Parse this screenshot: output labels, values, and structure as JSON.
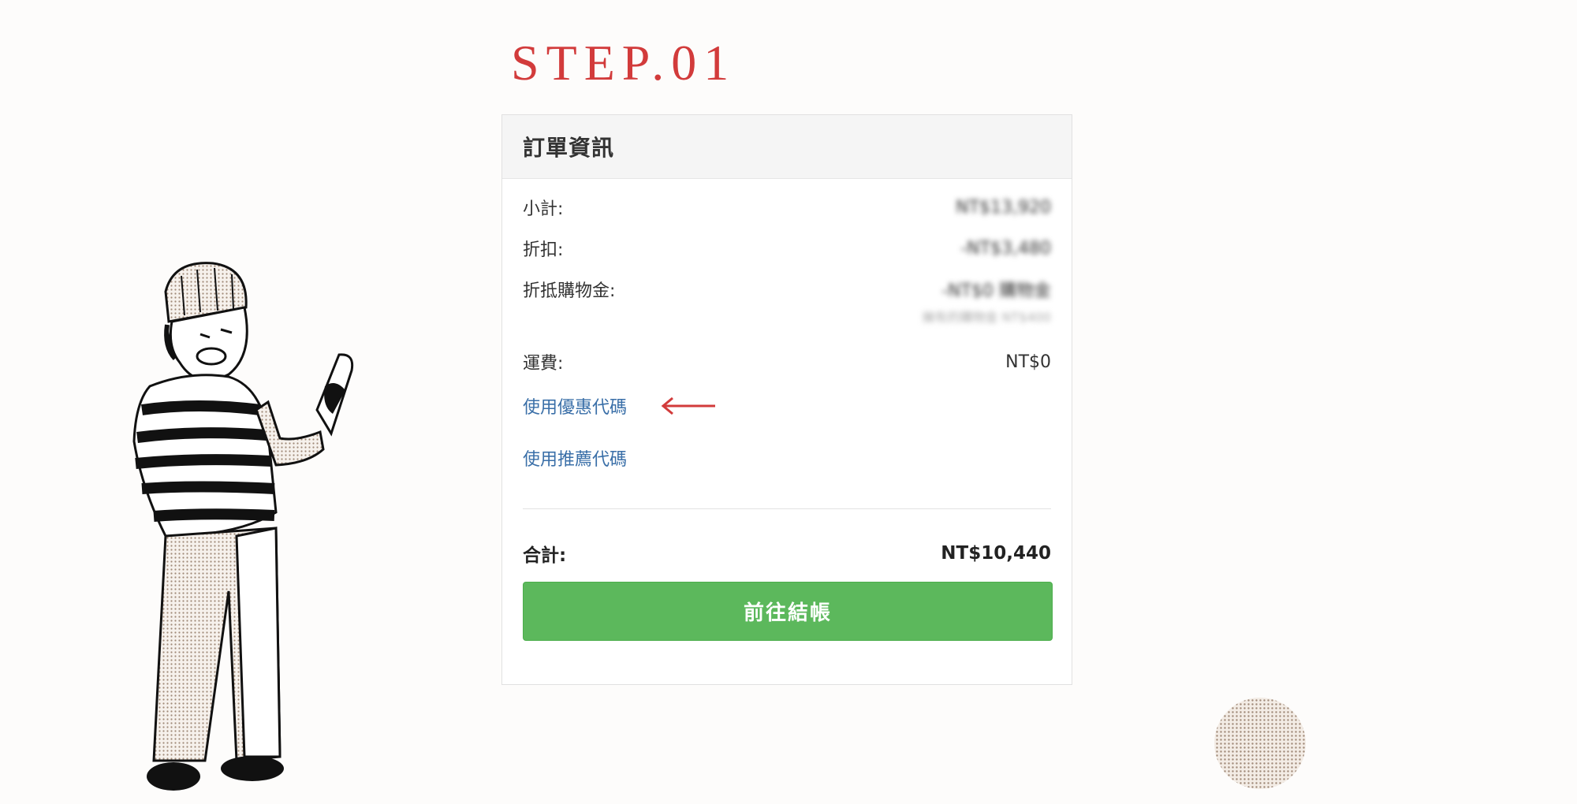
{
  "step": {
    "title": "STEP.01"
  },
  "order": {
    "title": "訂單資訊",
    "subtotal": {
      "label": "小計:",
      "value": "NT$13,920"
    },
    "discount": {
      "label": "折扣:",
      "value": "-NT$3,480"
    },
    "credit": {
      "label": "折抵購物金:",
      "value": "-NT$0 購物金",
      "note": "擁有的購物金 NT$400"
    },
    "shipping": {
      "label": "運費:",
      "value": "NT$0"
    },
    "coupon_link": "使用優惠代碼",
    "referral_link": "使用推薦代碼",
    "total": {
      "label": "合計:",
      "value": "NT$10,440"
    },
    "checkout_label": "前往結帳"
  },
  "colors": {
    "accent_red": "#d23b3b",
    "link_blue": "#3a6fa8",
    "button_green": "#5cb85c"
  },
  "icons": [
    "left-arrow-icon",
    "character-illustration",
    "dotted-circle-decoration"
  ]
}
